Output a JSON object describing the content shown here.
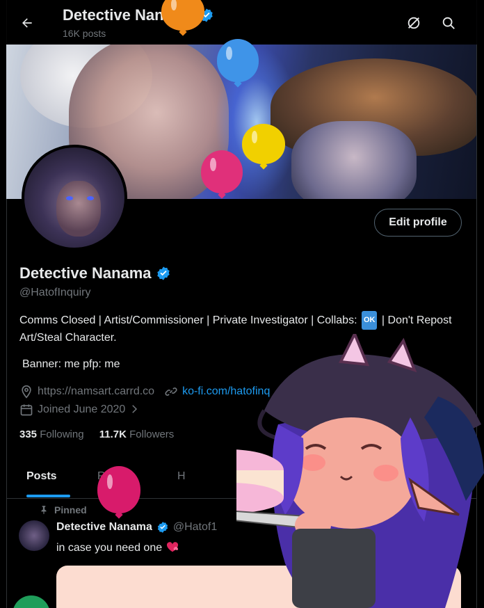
{
  "header": {
    "title": "Detective Nanama",
    "post_count": "16K posts"
  },
  "profile": {
    "name": "Detective Nanama",
    "handle": "@HatofInquiry",
    "edit_button": "Edit profile",
    "bio_part1": "Comms Closed | Artist/Commissioner | Private Investigator | Collabs:",
    "bio_ok": "OK",
    "bio_part2": "| Don't Repost Art/Steal Character.",
    "bio_line2": "Banner: me pfp: me",
    "website": "https://namsart.carrd.co",
    "kofi": "ko-fi.com/hatofinq",
    "joined": "Joined June 2020",
    "following_count": "335",
    "following_label": "Following",
    "followers_count": "11.7K",
    "followers_label": "Followers"
  },
  "tabs": {
    "posts": "Posts",
    "replies": "Replies",
    "third": "H"
  },
  "pinned_post": {
    "pinned_label": "Pinned",
    "author": "Detective Nanama",
    "handle": "@Hatof1",
    "text": "in case you need one"
  },
  "icons": {
    "back": "back-arrow-icon",
    "verified": "verified-badge-icon",
    "grok": "grok-icon",
    "search": "search-icon",
    "location": "location-icon",
    "link": "link-icon",
    "calendar": "calendar-icon",
    "pin": "pin-icon",
    "heart": "heart-icon"
  },
  "colors": {
    "background": "#000000",
    "accent": "#1d9bf0",
    "muted": "#71767b",
    "text": "#e7e9ea"
  }
}
